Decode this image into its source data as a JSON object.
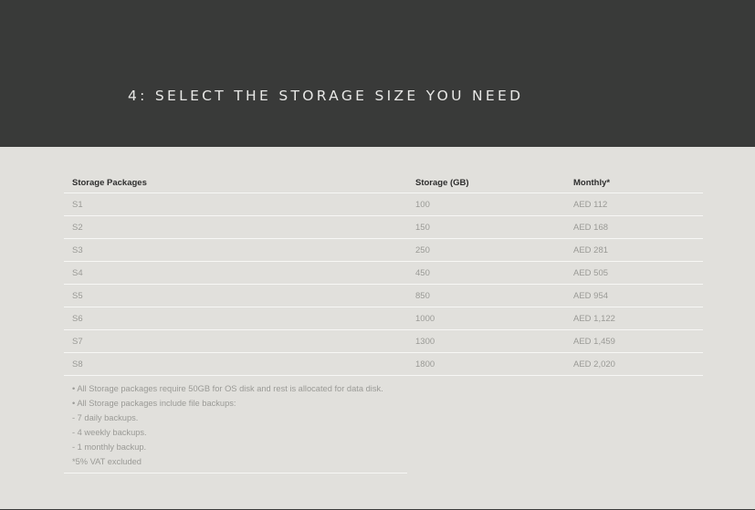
{
  "header": {
    "title": "4: SELECT THE STORAGE SIZE YOU NEED"
  },
  "table": {
    "headers": [
      "Storage Packages",
      "Storage (GB)",
      "Monthly*"
    ],
    "rows": [
      [
        "S1",
        "100",
        "AED 112"
      ],
      [
        "S2",
        "150",
        "AED 168"
      ],
      [
        "S3",
        "250",
        "AED 281"
      ],
      [
        "S4",
        "450",
        "AED 505"
      ],
      [
        "S5",
        "850",
        "AED 954"
      ],
      [
        "S6",
        "1000",
        "AED 1,122"
      ],
      [
        "S7",
        "1300",
        "AED 1,459"
      ],
      [
        "S8",
        "1800",
        "AED 2,020"
      ]
    ]
  },
  "notes": [
    "• All Storage packages require 50GB for OS disk and rest is allocated for data disk.",
    "• All Storage packages include file backups:",
    "- 7 daily backups.",
    "- 4 weekly backups.",
    "- 1 monthly backup.",
    "*5% VAT excluded"
  ],
  "colors": {
    "header_background": "#393a39",
    "page_background": "#e1e0dc",
    "title_text": "#e8e8e6",
    "header_text": "#2e2e2e",
    "body_text": "#9a9a96",
    "row_divider": "#f7f7f5"
  }
}
